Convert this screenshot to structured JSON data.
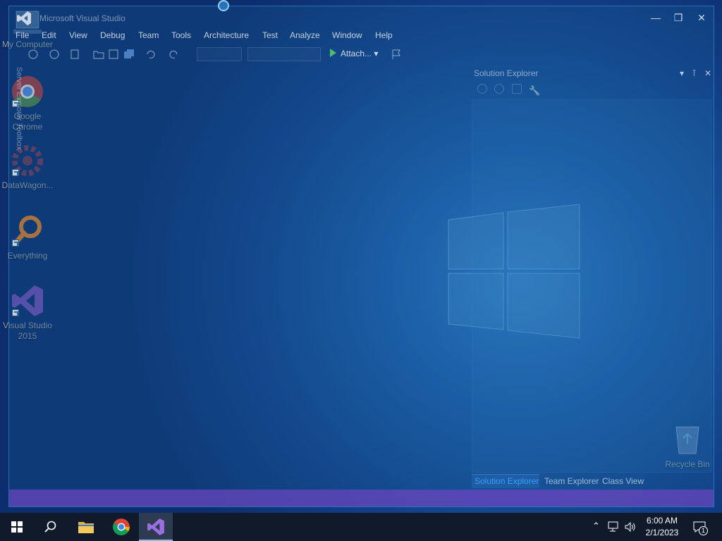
{
  "desktop": {
    "icons": [
      {
        "label": "My Computer"
      },
      {
        "label": "Google Chrome"
      },
      {
        "label": "DataWagon..."
      },
      {
        "label": "Everything"
      },
      {
        "label": "Visual Studio 2015"
      },
      {
        "label": "Recycle Bin"
      }
    ]
  },
  "vs": {
    "title": "Microsoft Visual Studio",
    "menu": [
      "File",
      "Edit",
      "View",
      "Debug",
      "Team",
      "Tools",
      "Architecture",
      "Test",
      "Analyze",
      "Window",
      "Help"
    ],
    "toolbar": {
      "attach_label": "Attach...",
      "attach_icon": "play-icon"
    },
    "side_tabs": [
      "Server Explorer",
      "Toolbox"
    ],
    "solution_explorer": {
      "title": "Solution Explorer",
      "tabs": [
        "Solution Explorer",
        "Team Explorer",
        "Class View"
      ],
      "active_tab": "Solution Explorer"
    },
    "colors": {
      "status_bar": "#6846be",
      "accent": "#3aa0ff"
    }
  },
  "taskbar": {
    "time": "6:00 AM",
    "date": "2/1/2023",
    "notification_count": "1",
    "apps": [
      "start-icon",
      "search-icon",
      "file-explorer-icon",
      "chrome-icon",
      "visual-studio-icon"
    ]
  }
}
